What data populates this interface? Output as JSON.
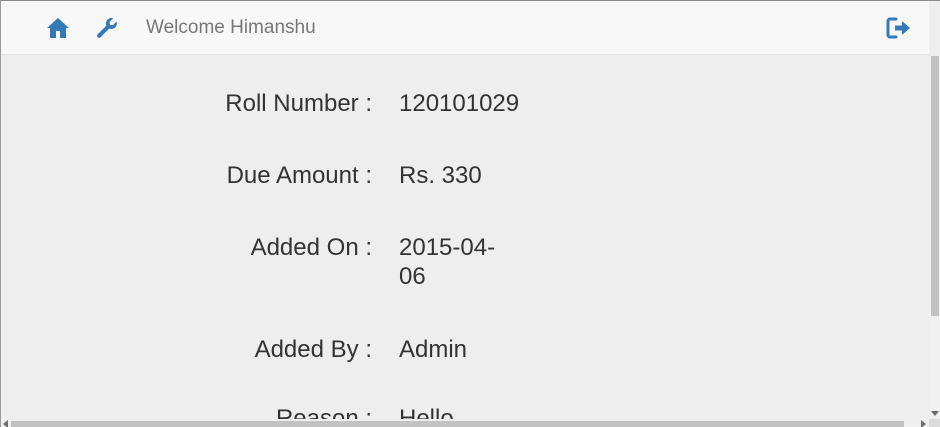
{
  "navbar": {
    "home_icon": "home-icon",
    "settings_icon": "wrench-icon",
    "welcome_text": "Welcome Himanshu",
    "logout_icon": "logout-icon",
    "icon_color": "#337ab7"
  },
  "details": [
    {
      "label": "Roll Number :",
      "value": "120101029"
    },
    {
      "label": "Due Amount :",
      "value": "Rs. 330"
    },
    {
      "label": "Added On :",
      "value": "2015-04-06"
    },
    {
      "label": "Added By :",
      "value": "Admin"
    },
    {
      "label": "Reason :",
      "value": "Hello"
    }
  ]
}
